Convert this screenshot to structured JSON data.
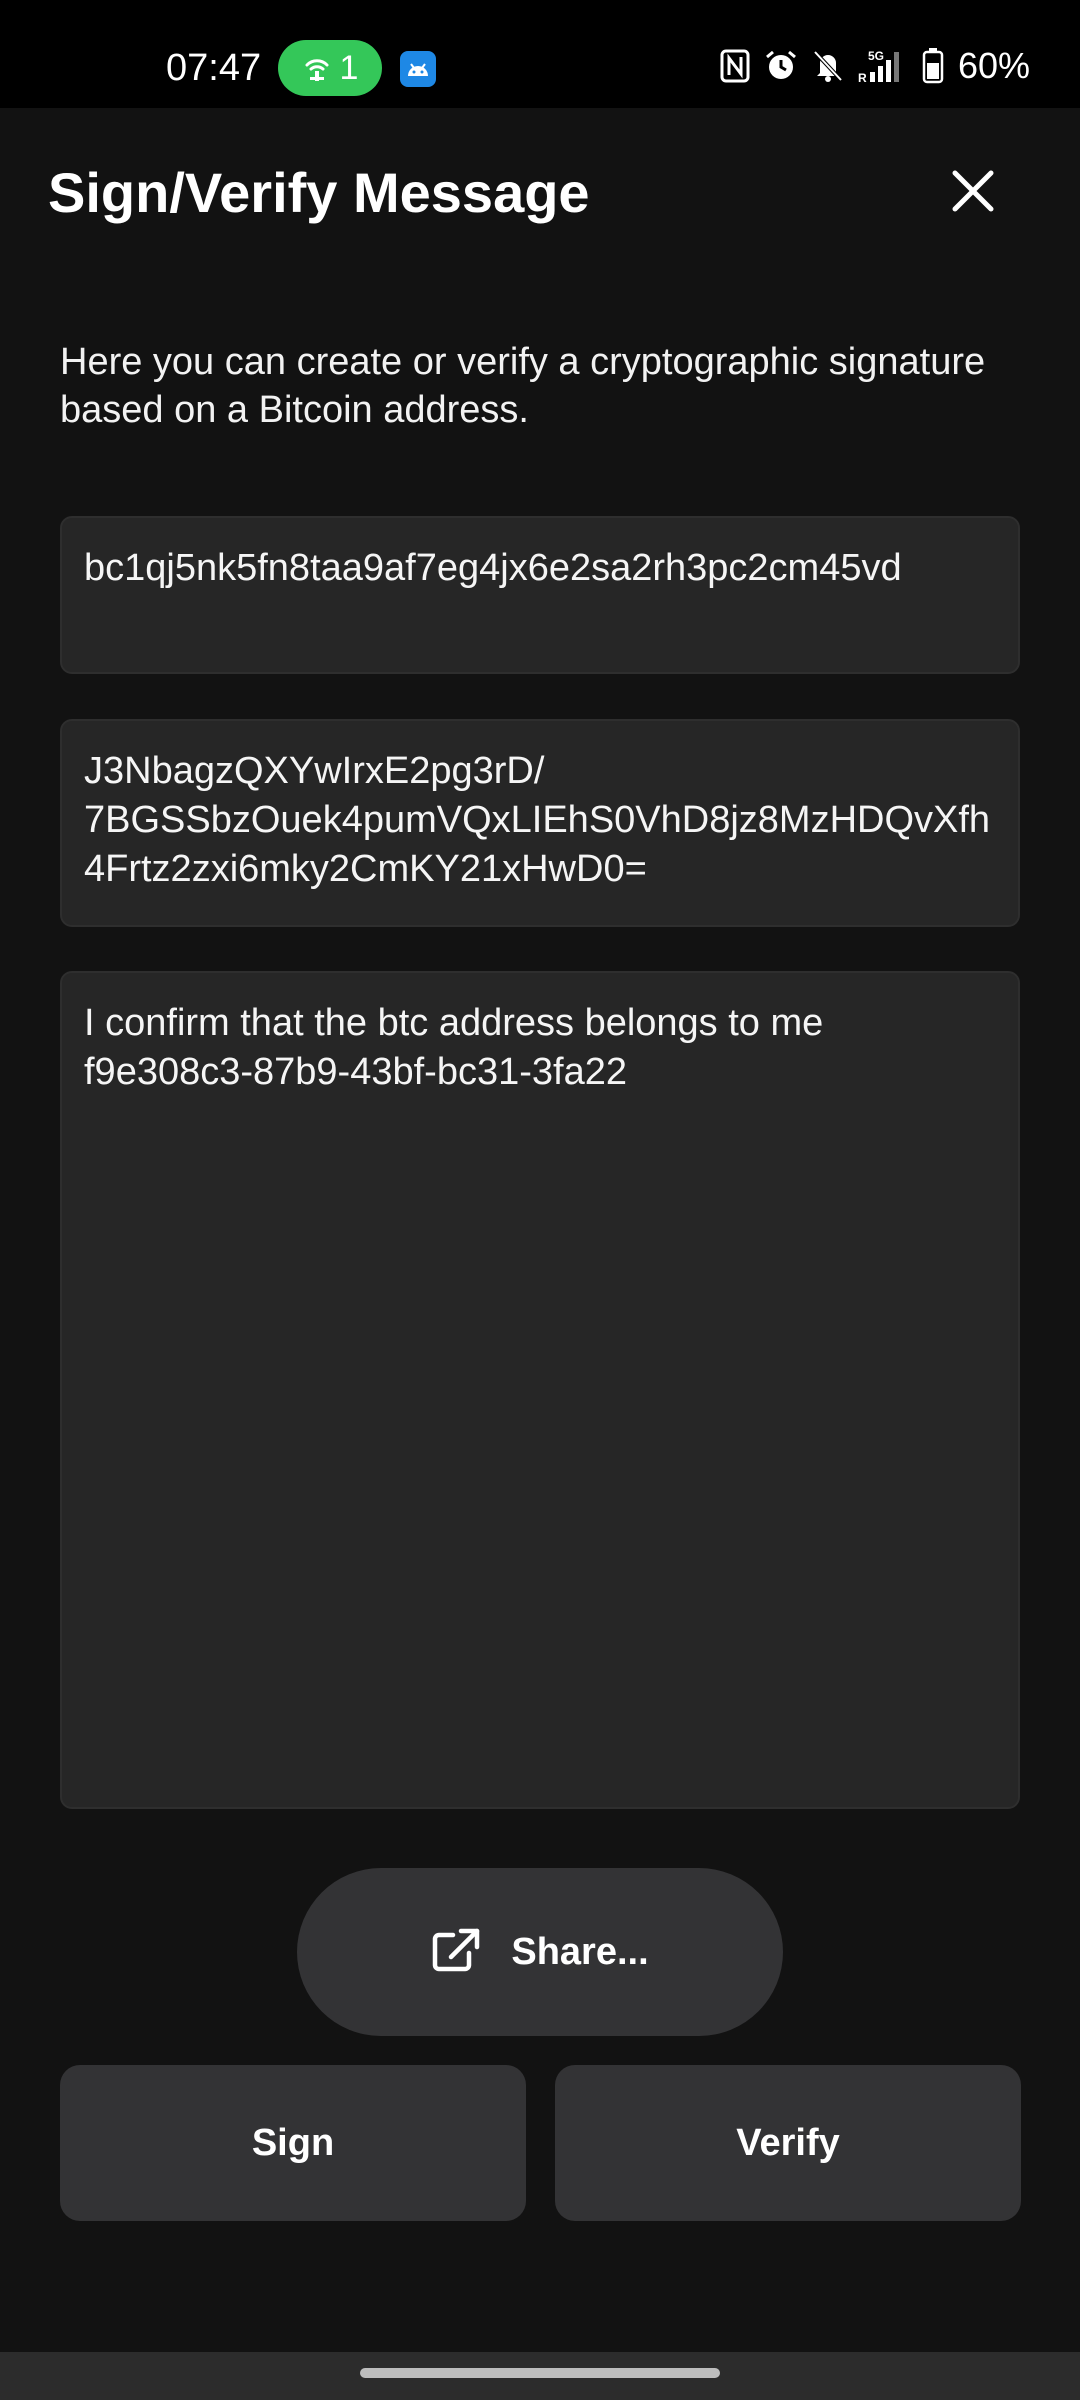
{
  "status_bar": {
    "time": "07:47",
    "hotspot_count": "1",
    "battery": "60%",
    "icons": [
      "hotspot-icon",
      "android-app-icon",
      "nfc-icon",
      "alarm-icon",
      "mute-icon",
      "signal-5g-icon",
      "battery-icon"
    ]
  },
  "header": {
    "title": "Sign/Verify Message",
    "close_icon": "close-icon"
  },
  "description": "Here you can create or verify a cryptographic signature based on a Bitcoin address.",
  "fields": {
    "address": "bc1qj5nk5fn8taa9af7eg4jx6e2sa2rh3pc2cm45vd",
    "signature": "J3NbagzQXYwIrxE2pg3rD/\n7BGSSbzOuek4pumVQxLIEhS0VhD8jz8MzHDQvXfh4Frtz2zxi6mky2CmKY21xHwD0=",
    "message": "I confirm that the btc address belongs to me\nf9e308c3-87b9-43bf-bc31-3fa22"
  },
  "buttons": {
    "share_label": "Share...",
    "share_icon": "external-share-icon",
    "sign_label": "Sign",
    "verify_label": "Verify"
  },
  "colors": {
    "background": "#121212",
    "field_background": "#262626",
    "button_background": "#333335",
    "hotspot_green": "#34c759"
  }
}
